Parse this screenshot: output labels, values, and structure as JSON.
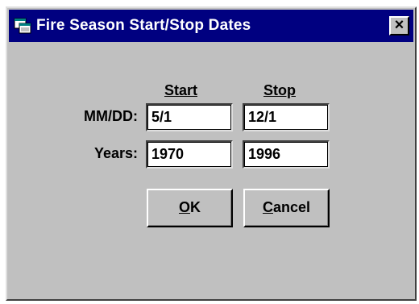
{
  "window": {
    "title": "Fire Season Start/Stop Dates",
    "close_label": "×",
    "icon": "app-window-icon"
  },
  "columns": {
    "start": "Start",
    "stop": "Stop"
  },
  "rows": {
    "mmdd_label": "MM/DD:",
    "years_label": "Years:"
  },
  "fields": {
    "mmdd_start": "5/1",
    "mmdd_stop": "12/1",
    "years_start": "1970",
    "years_stop": "1996"
  },
  "buttons": {
    "ok_mnemonic": "O",
    "ok_rest": "K",
    "cancel_mnemonic": "C",
    "cancel_rest": "ancel"
  },
  "colors": {
    "title_bar": "#000080",
    "dialog_face": "#c0c0c0"
  }
}
